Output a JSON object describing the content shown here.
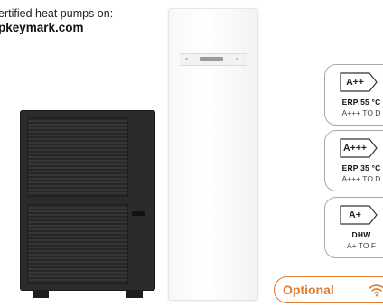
{
  "heading": {
    "line1": "ertified heat pumps on:",
    "line2": "pkeymark.com"
  },
  "badges": [
    {
      "class": "A++",
      "label": "ERP 55 °C",
      "range": "A+++ TO D"
    },
    {
      "class": "A+++",
      "label": "ERP 35 °C",
      "range": "A+++ TO D"
    },
    {
      "class": "A+",
      "label": "DHW",
      "range": "A+ TO F"
    }
  ],
  "optional": {
    "label": "Optional",
    "icon": "wifi-icon"
  },
  "colors": {
    "accent": "#e07a2f",
    "badge_border": "#a9a9a9",
    "outdoor_unit": "#2b2b2b"
  }
}
